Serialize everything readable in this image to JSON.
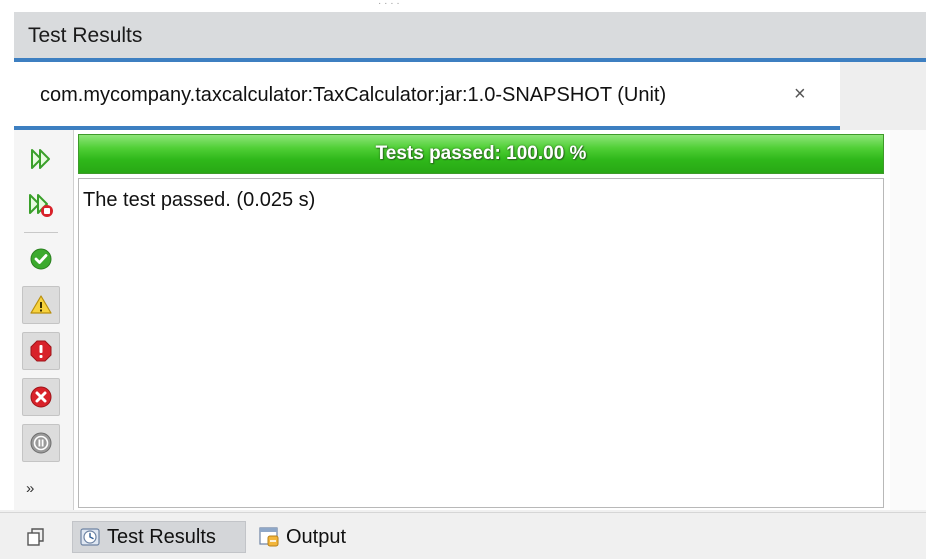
{
  "window": {
    "title": "Test Results"
  },
  "top_strip": {
    "glyphs": "· · · ·"
  },
  "document_tab": {
    "label": "com.mycompany.taxcalculator:TaxCalculator:jar:1.0-SNAPSHOT (Unit)",
    "close_glyph": "×"
  },
  "toolbar": {
    "buttons": [
      {
        "name": "rerun-icon",
        "pressed": false
      },
      {
        "name": "rerun-failed-icon",
        "pressed": false
      },
      {
        "name": "show-passed-icon",
        "pressed": false
      },
      {
        "name": "show-passed-with-errors-icon",
        "pressed": true
      },
      {
        "name": "show-failures-icon",
        "pressed": true
      },
      {
        "name": "show-errors-icon",
        "pressed": true
      },
      {
        "name": "show-aborted-icon",
        "pressed": true
      }
    ],
    "more_label": "»"
  },
  "progress": {
    "label": "Tests passed: 100.00 %",
    "percent": 100,
    "color": "#2fb81a"
  },
  "output": {
    "lines": [
      "The test passed. (0.025 s)"
    ]
  },
  "bottom_tabs": [
    {
      "label": "Test Results",
      "icon": "test-results-icon",
      "active": true
    },
    {
      "label": "Output",
      "icon": "output-icon",
      "active": false
    }
  ],
  "colors": {
    "accent": "#3d7fc1",
    "progress_green": "#2fb81a"
  }
}
